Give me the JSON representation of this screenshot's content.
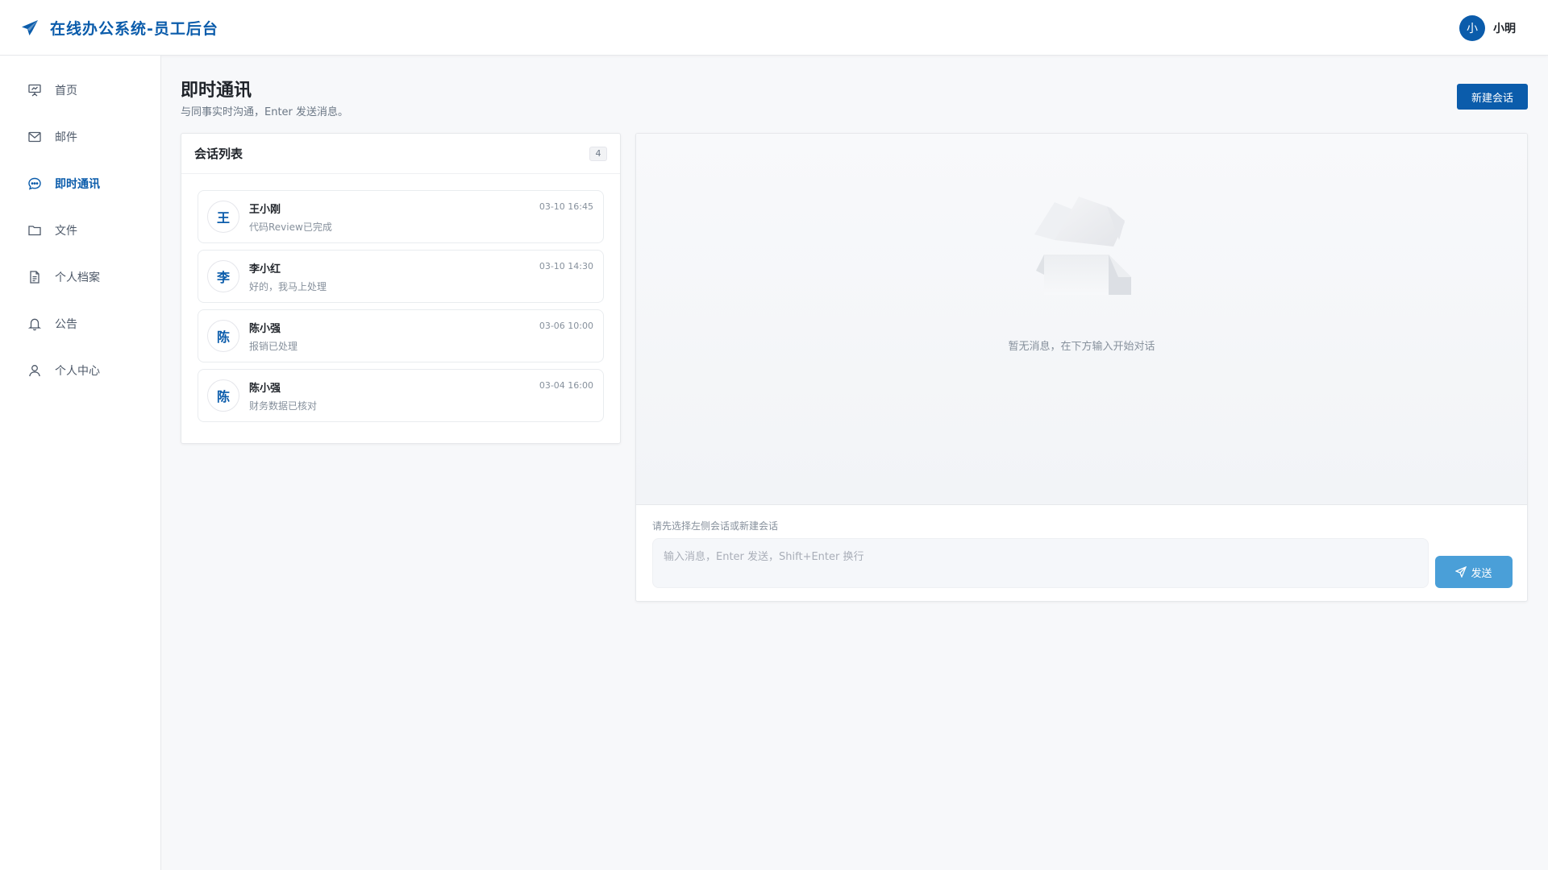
{
  "header": {
    "title": "在线办公系统-员工后台",
    "user": {
      "avatar_text": "小",
      "name": "小明"
    },
    "brand_color": "#0b5cab"
  },
  "sidebar": {
    "items": [
      {
        "label": "首页",
        "icon": "presentation-icon",
        "active": false
      },
      {
        "label": "邮件",
        "icon": "mail-icon",
        "active": false
      },
      {
        "label": "即时通讯",
        "icon": "chat-bubble-icon",
        "active": true
      },
      {
        "label": "文件",
        "icon": "folder-icon",
        "active": false
      },
      {
        "label": "个人档案",
        "icon": "document-icon",
        "active": false
      },
      {
        "label": "公告",
        "icon": "bell-icon",
        "active": false
      },
      {
        "label": "个人中心",
        "icon": "user-icon",
        "active": false
      }
    ]
  },
  "main": {
    "title": "即时通讯",
    "subtitle": "与同事实时沟通，Enter 发送消息。",
    "new_button": "新建会话"
  },
  "conversations": {
    "title": "会话列表",
    "count": "4",
    "items": [
      {
        "avatar": "王",
        "name": "王小刚",
        "preview": "代码Review已完成",
        "time": "03-10 16:45"
      },
      {
        "avatar": "李",
        "name": "李小红",
        "preview": "好的，我马上处理",
        "time": "03-10 14:30"
      },
      {
        "avatar": "陈",
        "name": "陈小强",
        "preview": "报销已处理",
        "time": "03-06 10:00"
      },
      {
        "avatar": "陈",
        "name": "陈小强",
        "preview": "财务数据已核对",
        "time": "03-04 16:00"
      }
    ]
  },
  "chat": {
    "empty_text": "暂无消息，在下方输入开始对话",
    "hint": "请先选择左侧会话或新建会话",
    "input_placeholder": "输入消息，Enter 发送，Shift+Enter 换行",
    "input_value": "",
    "send_button": "发送",
    "send_color": "#4a9fd8"
  }
}
